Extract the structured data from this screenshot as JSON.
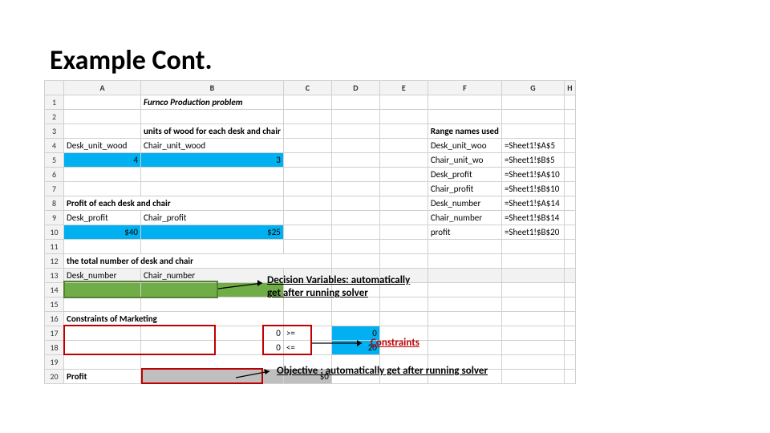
{
  "title": "Example Cont.",
  "columns": [
    "A",
    "B",
    "C",
    "D",
    "E",
    "F",
    "G",
    "H"
  ],
  "rows": {
    "r1": {
      "B": "Furnco Production problem"
    },
    "r3": {
      "B": "units of wood for each desk and chair",
      "F": "Range names used"
    },
    "r4": {
      "A": "Desk_unit_wood",
      "B": "Chair_unit_wood",
      "F": "Desk_unit_woo",
      "G": "=Sheet1!$A$5"
    },
    "r5": {
      "A": "4",
      "B": "3",
      "F": "Chair_unit_wo",
      "G": "=Sheet1!$B$5"
    },
    "r6": {
      "F": "Desk_profit",
      "G": "=Sheet1!$A$10"
    },
    "r7": {
      "F": "Chair_profit",
      "G": "=Sheet1!$B$10"
    },
    "r8": {
      "A": "Profit of each desk and chair",
      "F": "Desk_number",
      "G": "=Sheet1!$A$14"
    },
    "r9": {
      "A": "Desk_profit",
      "B": "Chair_profit",
      "F": "Chair_number",
      "G": "=Sheet1!$B$14"
    },
    "r10": {
      "A": "$40",
      "B": "$25",
      "F": "profit",
      "G": "=Sheet1!$B$20"
    },
    "r12": {
      "A": "the total number of desk and chair"
    },
    "r13": {
      "A": "Desk_number",
      "B": "Chair_number"
    },
    "r16": {
      "A": "Constraints of Marketing"
    },
    "r17": {
      "B": "0",
      "C": ">=",
      "D": "0"
    },
    "r18": {
      "B": "0",
      "C": "<=",
      "D": "20"
    },
    "r20": {
      "A": "Profit",
      "C": "$0"
    }
  },
  "annot": {
    "decision": "Decision Variables: automatically\nget after running solver",
    "constraints": "Constraints",
    "objective": "Objective : automatically get after running solver"
  }
}
